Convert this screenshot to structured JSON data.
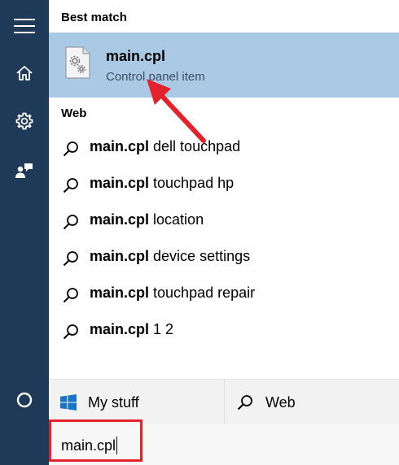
{
  "rail": {
    "items": [
      {
        "id": "menu",
        "icon": "hamburger-menu-icon"
      },
      {
        "id": "home",
        "icon": "home-icon"
      },
      {
        "id": "settings",
        "icon": "gear-icon"
      },
      {
        "id": "feedback",
        "icon": "feedback-person-icon"
      },
      {
        "id": "cortana",
        "icon": "cortana-circle-icon"
      }
    ],
    "background": "#1f3a58"
  },
  "best_match": {
    "label": "Best match",
    "title": "main.cpl",
    "subtitle": "Control panel item",
    "icon": "control-panel-gear-file-icon",
    "highlight_color": "#a9c9e4"
  },
  "web": {
    "label": "Web",
    "suggestions": [
      {
        "bold": "main.cpl",
        "rest": " dell touchpad"
      },
      {
        "bold": "main.cpl",
        "rest": " touchpad hp"
      },
      {
        "bold": "main.cpl",
        "rest": " location"
      },
      {
        "bold": "main.cpl",
        "rest": " device settings"
      },
      {
        "bold": "main.cpl",
        "rest": " touchpad repair"
      },
      {
        "bold": "main.cpl",
        "rest": " 1 2"
      }
    ]
  },
  "bottom_bar": {
    "my_stuff_label": "My stuff",
    "web_label": "Web"
  },
  "search": {
    "value": "main.cpl"
  },
  "annotations": {
    "highlight_color": "#e3222c"
  }
}
